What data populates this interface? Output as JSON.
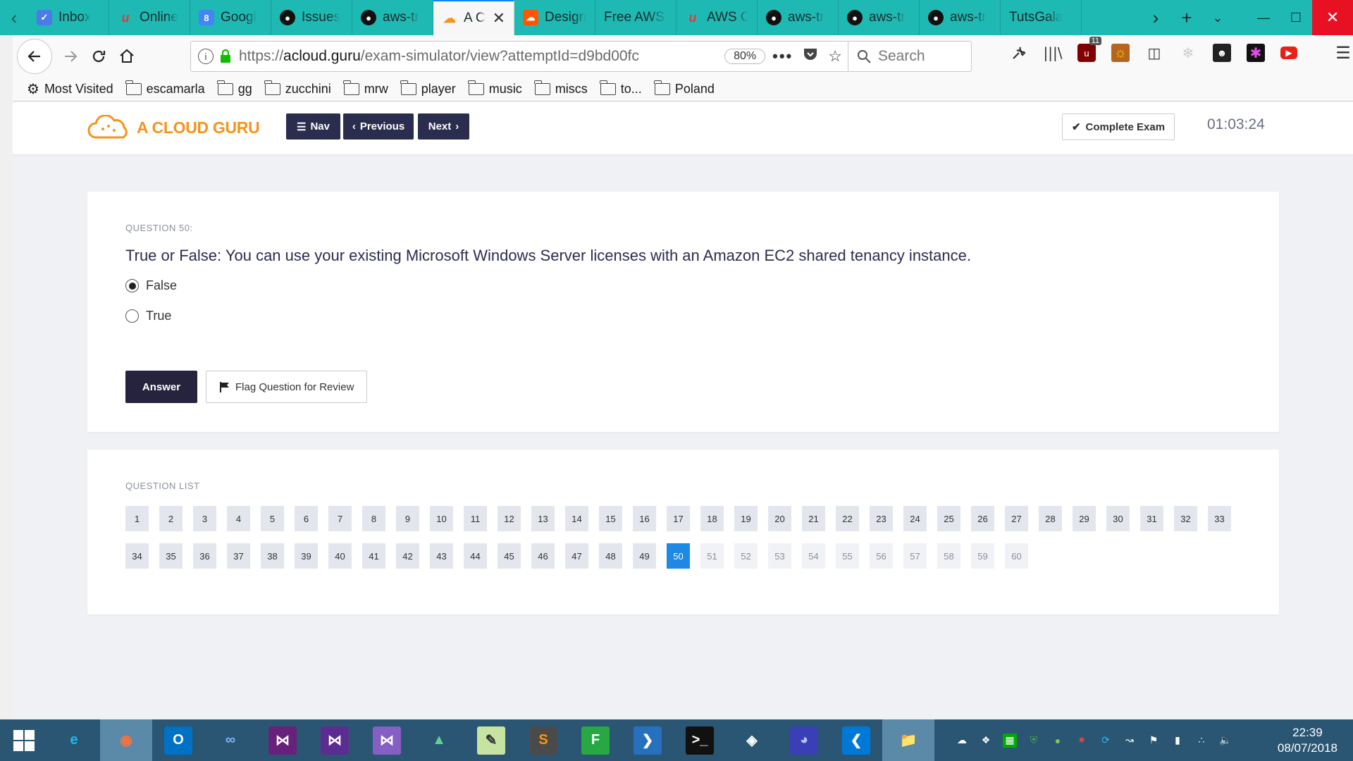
{
  "browser": {
    "tabs": [
      {
        "label": "Inbox",
        "icon": "inbox-icon",
        "color": "#4a7be8"
      },
      {
        "label": "Online",
        "icon": "udemy-icon",
        "color": "#e23a3a"
      },
      {
        "label": "Googl",
        "icon": "google-calendar-icon",
        "color": "#4285f4"
      },
      {
        "label": "Issues",
        "icon": "github-icon",
        "color": "#111111"
      },
      {
        "label": "aws-tr",
        "icon": "github-icon",
        "color": "#111111"
      },
      {
        "label": "A C",
        "icon": "acloudguru-icon",
        "color": "#f7931e",
        "active": true
      },
      {
        "label": "Design",
        "icon": "soundcloud-icon",
        "color": "#ff5500"
      },
      {
        "label": "Free AWS-",
        "icon": "",
        "color": ""
      },
      {
        "label": "AWS C",
        "icon": "udemy-icon",
        "color": "#e23a3a"
      },
      {
        "label": "aws-tr",
        "icon": "github-icon",
        "color": "#111111"
      },
      {
        "label": "aws-tr",
        "icon": "github-icon",
        "color": "#111111"
      },
      {
        "label": "aws-tr",
        "icon": "github-icon",
        "color": "#111111"
      },
      {
        "label": "TutsGala",
        "icon": "",
        "color": ""
      }
    ],
    "url_prefix": "https://",
    "url_host": "acloud.guru",
    "url_path": "/exam-simulator/view?attemptId=d9bd00fc",
    "zoom": "80%",
    "search_placeholder": "Search",
    "ublock_badge": "11",
    "bookmarks": [
      {
        "label": "Most Visited",
        "type": "gear"
      },
      {
        "label": "escamarla",
        "type": "folder"
      },
      {
        "label": "gg",
        "type": "folder"
      },
      {
        "label": "zucchini",
        "type": "folder"
      },
      {
        "label": "mrw",
        "type": "folder"
      },
      {
        "label": "player",
        "type": "folder"
      },
      {
        "label": "music",
        "type": "folder"
      },
      {
        "label": "miscs",
        "type": "folder"
      },
      {
        "label": "to...",
        "type": "folder"
      },
      {
        "label": "Poland",
        "type": "folder"
      }
    ]
  },
  "header": {
    "logo_text": "A CLOUD GURU",
    "nav_label": "Nav",
    "previous_label": "Previous",
    "next_label": "Next",
    "complete_label": "Complete Exam",
    "timer": "01:03:24"
  },
  "question": {
    "number_label": "QUESTION 50:",
    "text": "True or False: You can use your existing Microsoft Windows Server licenses with an Amazon EC2 shared tenancy instance.",
    "options": [
      {
        "label": "False",
        "selected": true
      },
      {
        "label": "True",
        "selected": false
      }
    ],
    "answer_label": "Answer",
    "flag_label": "Flag Question for Review"
  },
  "question_list": {
    "label": "QUESTION LIST",
    "total": 60,
    "current": 50,
    "answered_up_to": 49
  },
  "taskbar": {
    "apps": [
      "internet-explorer-icon",
      "firefox-icon",
      "outlook-icon",
      "infinity-icon",
      "visual-studio-icon",
      "visual-studio-preview-icon",
      "visual-studio-purple-icon",
      "rocket-icon",
      "notepad-icon",
      "sublime-text-icon",
      "fork-icon",
      "powershell-icon",
      "terminal-icon",
      "network-icon",
      "globe-icon",
      "vscode-icon",
      "file-explorer-icon"
    ],
    "time": "22:39",
    "date": "08/07/2018"
  },
  "colors": {
    "tab_bar": "#1fb9b3",
    "brand_orange": "#f7931e",
    "nav_button": "#2b2d4f",
    "answer_button": "#25233d",
    "current_question": "#1e88e5",
    "taskbar": "#2a5673"
  }
}
